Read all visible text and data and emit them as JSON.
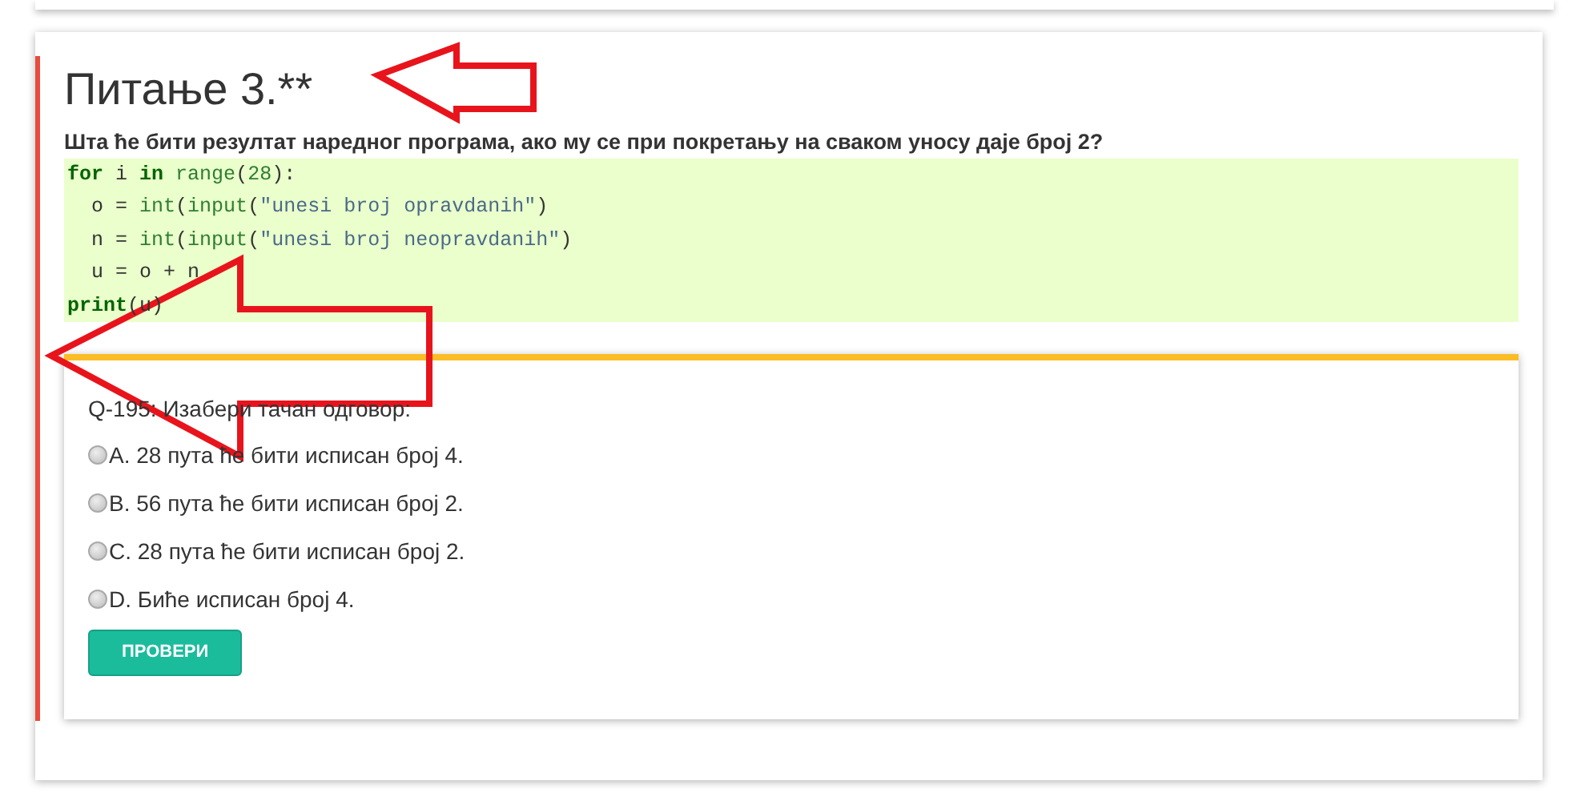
{
  "question": {
    "title": "Питање 3.**",
    "prompt": "Шта ће бити резултат наредног програма, ако му се при покретању на сваком уносу даје број 2?",
    "code": [
      [
        {
          "kind": "keyword",
          "text": "for"
        },
        {
          "kind": "plain",
          "text": " i "
        },
        {
          "kind": "keyword",
          "text": "in"
        },
        {
          "kind": "builtin",
          "text": " range"
        },
        {
          "kind": "plain",
          "text": "("
        },
        {
          "kind": "number",
          "text": "28"
        },
        {
          "kind": "plain",
          "text": "):"
        }
      ],
      [
        {
          "kind": "plain",
          "text": "  o = "
        },
        {
          "kind": "builtin",
          "text": "int"
        },
        {
          "kind": "plain",
          "text": "("
        },
        {
          "kind": "builtin",
          "text": "input"
        },
        {
          "kind": "plain",
          "text": "("
        },
        {
          "kind": "string",
          "text": "\"unesi broj opravdanih\""
        },
        {
          "kind": "plain",
          "text": ")"
        }
      ],
      [
        {
          "kind": "plain",
          "text": "  n = "
        },
        {
          "kind": "builtin",
          "text": "int"
        },
        {
          "kind": "plain",
          "text": "("
        },
        {
          "kind": "builtin",
          "text": "input"
        },
        {
          "kind": "plain",
          "text": "("
        },
        {
          "kind": "string",
          "text": "\"unesi broj neopravdanih\""
        },
        {
          "kind": "plain",
          "text": ")"
        }
      ],
      [
        {
          "kind": "plain",
          "text": "  u = o + n"
        }
      ],
      [
        {
          "kind": "keyword",
          "text": "print"
        },
        {
          "kind": "plain",
          "text": "(u)"
        }
      ]
    ]
  },
  "quiz": {
    "label": "Q-195: Изабери тачан одговор:",
    "options": [
      {
        "text": "А. 28 пута ће бити исписан број 4.",
        "selected": false
      },
      {
        "text": "B. 56 пута ће бити исписан број 2.",
        "selected": false
      },
      {
        "text": "C. 28 пута ће бити исписан број 2.",
        "selected": false
      },
      {
        "text": "D. Биће исписан број 4.",
        "selected": false
      }
    ],
    "button": "ПРОВЕРИ"
  }
}
